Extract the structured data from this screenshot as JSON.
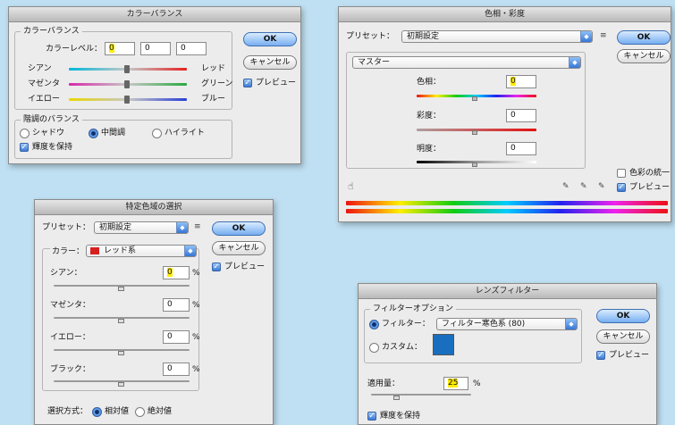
{
  "colorBalance": {
    "title": "カラーバランス",
    "groupTitle": "カラーバランス",
    "levelLabel": "カラーレベル：",
    "levels": [
      "0",
      "0",
      "0"
    ],
    "sliders": [
      {
        "left": "シアン",
        "right": "レッド",
        "value": 0
      },
      {
        "left": "マゼンタ",
        "right": "グリーン",
        "value": 0
      },
      {
        "left": "イエロー",
        "right": "ブルー",
        "value": 0
      }
    ],
    "toneGroupTitle": "階調のバランス",
    "tones": [
      "シャドウ",
      "中間調",
      "ハイライト"
    ],
    "selectedTone": "中間調",
    "preserveLuminosity": "輝度を保持",
    "ok": "OK",
    "cancel": "キャンセル",
    "preview": "プレビュー"
  },
  "hueSat": {
    "title": "色相・彩度",
    "presetLabel": "プリセット：",
    "preset": "初期設定",
    "channel": "マスター",
    "hueLabel": "色相：",
    "hue": "0",
    "satLabel": "彩度：",
    "sat": "0",
    "lightLabel": "明度：",
    "light": "0",
    "colorize": "色彩の統一",
    "preview": "プレビュー",
    "ok": "OK",
    "cancel": "キャンセル"
  },
  "selectiveColor": {
    "title": "特定色域の選択",
    "presetLabel": "プリセット：",
    "preset": "初期設定",
    "colorLabel": "カラー：",
    "color": "レッド系",
    "swatchColor": "#d62020",
    "rows": [
      {
        "label": "シアン：",
        "value": "0",
        "unit": "%"
      },
      {
        "label": "マゼンタ：",
        "value": "0",
        "unit": "%"
      },
      {
        "label": "イエロー：",
        "value": "0",
        "unit": "%"
      },
      {
        "label": "ブラック：",
        "value": "0",
        "unit": "%"
      }
    ],
    "methodLabel": "選択方式：",
    "methods": [
      "相対値",
      "絶対値"
    ],
    "selectedMethod": "相対値",
    "ok": "OK",
    "cancel": "キャンセル",
    "preview": "プレビュー"
  },
  "lensFilter": {
    "title": "レンズフィルター",
    "groupTitle": "フィルターオプション",
    "filterLabel": "フィルター：",
    "filter": "フィルター寒色系 (80)",
    "customLabel": "カスタム：",
    "customColor": "#1a6ec0",
    "densityLabel": "適用量：",
    "density": "25",
    "densityUnit": "%",
    "densityLevel": 0.25,
    "preserveLuminosity": "輝度を保持",
    "ok": "OK",
    "cancel": "キャンセル",
    "preview": "プレビュー"
  }
}
